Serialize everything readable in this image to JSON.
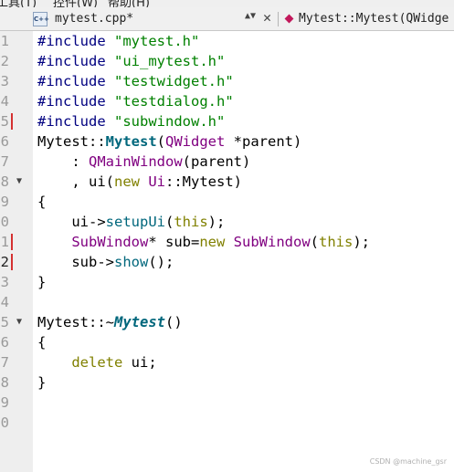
{
  "menubar": {
    "items": [
      "工具(T)",
      "控件(W)",
      "帮助(H)"
    ]
  },
  "tabbar": {
    "file_icon_text": "C++",
    "file_name": "mytest.cpp*",
    "symbol_name": "Mytest::Mytest(QWidge"
  },
  "lines": [
    {
      "num": "1",
      "code": "#include \"mytest.h\""
    },
    {
      "num": "2",
      "code": "#include \"ui_mytest.h\""
    },
    {
      "num": "3",
      "code": "#include \"testwidget.h\""
    },
    {
      "num": "4",
      "code": "#include \"testdialog.h\""
    },
    {
      "num": "5",
      "code": "#include \"subwindow.h\""
    },
    {
      "num": "6",
      "code": "Mytest::Mytest(QWidget *parent)"
    },
    {
      "num": "7",
      "code": "    : QMainWindow(parent)"
    },
    {
      "num": "8",
      "code": "    , ui(new Ui::Mytest)"
    },
    {
      "num": "9",
      "code": "{"
    },
    {
      "num": "0",
      "code": "    ui->setupUi(this);"
    },
    {
      "num": "1",
      "code": "    SubWindow* sub=new SubWindow(this);"
    },
    {
      "num": "2",
      "code": "    sub->show();"
    },
    {
      "num": "3",
      "code": "}"
    },
    {
      "num": "4",
      "code": ""
    },
    {
      "num": "5",
      "code": "Mytest::~Mytest()"
    },
    {
      "num": "6",
      "code": "{"
    },
    {
      "num": "7",
      "code": "    delete ui;"
    },
    {
      "num": "8",
      "code": "}"
    },
    {
      "num": "9",
      "code": ""
    },
    {
      "num": "0",
      "code": ""
    }
  ],
  "watermark": "CSDN @machine_gsr"
}
